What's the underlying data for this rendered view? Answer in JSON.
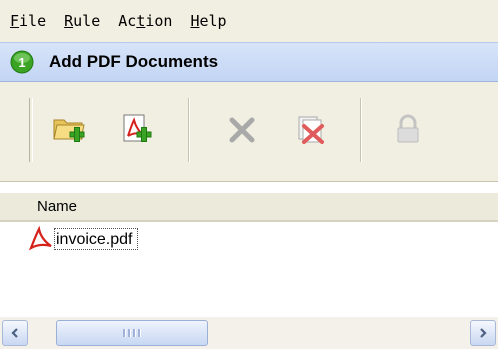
{
  "menu": {
    "items": [
      {
        "accel": "F",
        "rest": "ile"
      },
      {
        "accel": "R",
        "rest": "ule"
      },
      {
        "pre": "Ac",
        "accel": "t",
        "rest": "ion"
      },
      {
        "accel": "H",
        "rest": "elp"
      }
    ]
  },
  "header": {
    "title": "Add PDF Documents"
  },
  "toolbar": {
    "buttons": [
      {
        "icon": "add-folder-icon",
        "enabled": true
      },
      {
        "icon": "add-pdf-icon",
        "enabled": true
      },
      {
        "icon": "remove-icon",
        "enabled": false
      },
      {
        "icon": "remove-all-icon",
        "enabled": false
      },
      {
        "icon": "lock-icon",
        "enabled": false
      }
    ]
  },
  "list": {
    "column_header": "Name",
    "rows": [
      {
        "name": "invoice.pdf",
        "icon": "pdf-file-icon"
      }
    ]
  },
  "colors": {
    "menubar": "#f1efe2",
    "header": "#c9daf5",
    "accent_green": "#3aa324"
  }
}
